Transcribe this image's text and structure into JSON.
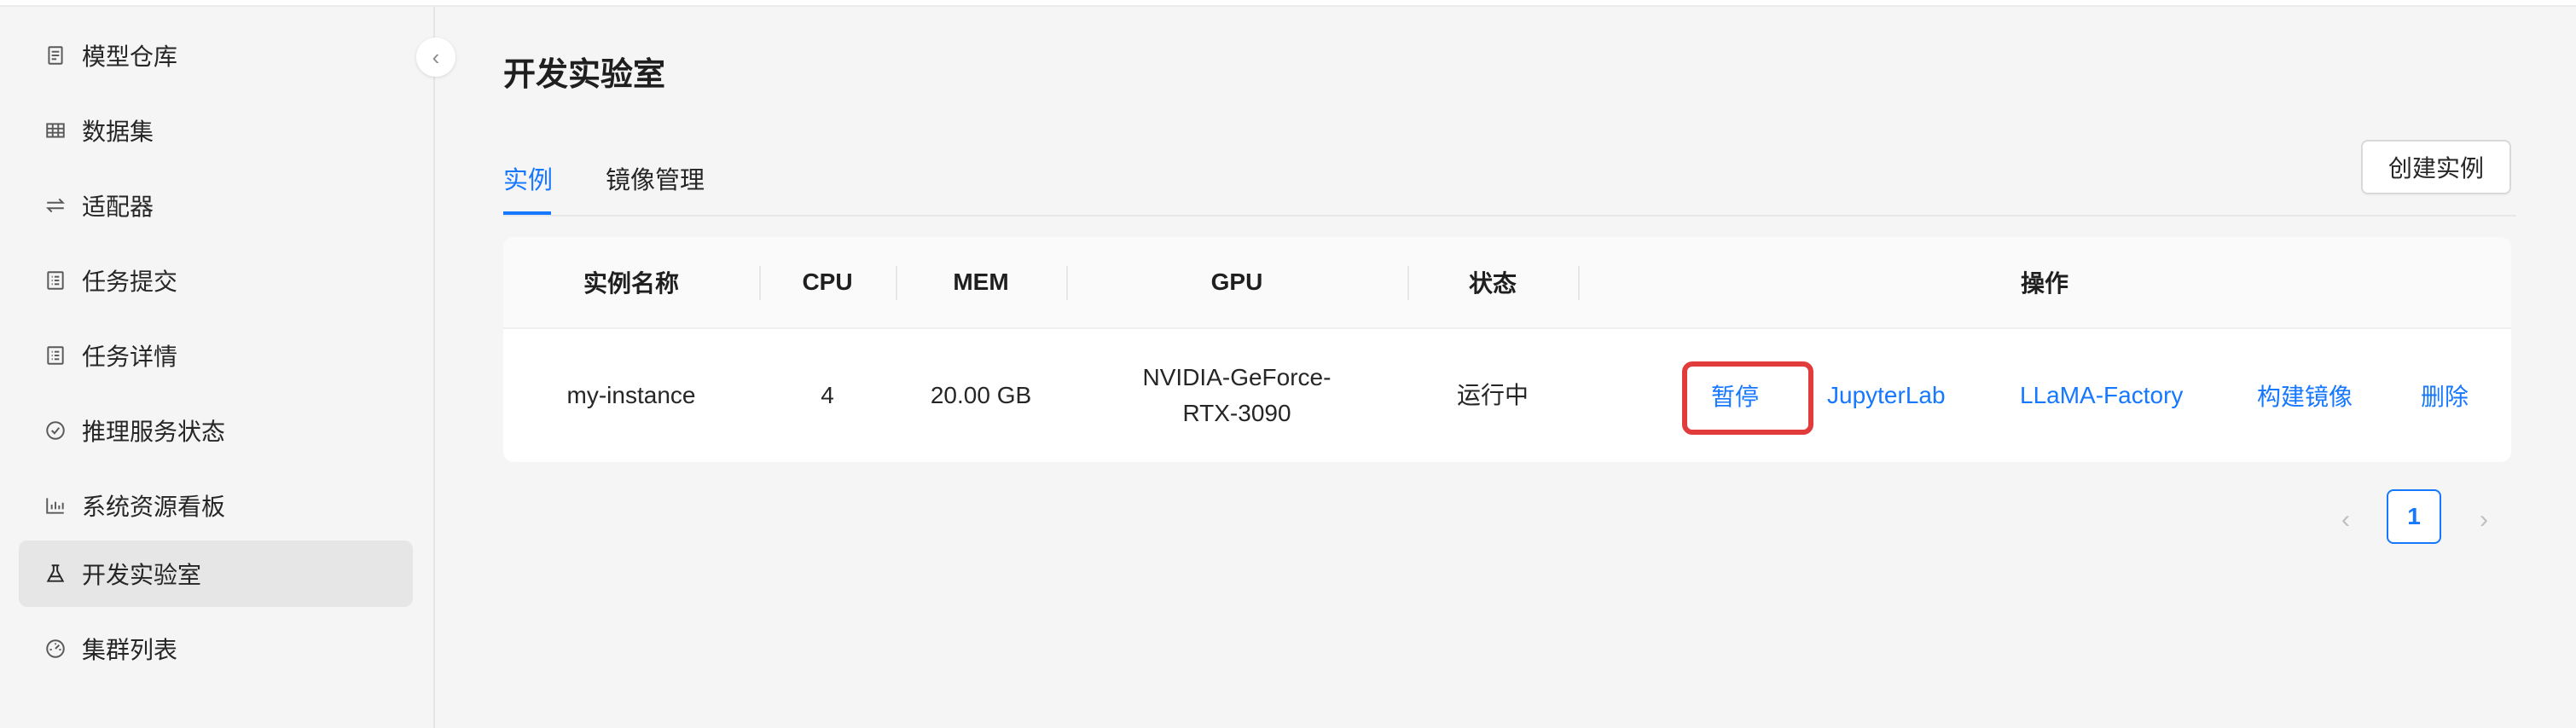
{
  "sidebar": {
    "collapse_icon": "chevron-left-icon",
    "items": [
      {
        "label": "模型仓库",
        "icon": "file-icon"
      },
      {
        "label": "数据集",
        "icon": "table-icon"
      },
      {
        "label": "适配器",
        "icon": "swap-icon"
      },
      {
        "label": "任务提交",
        "icon": "form-icon"
      },
      {
        "label": "任务详情",
        "icon": "profile-icon"
      },
      {
        "label": "推理服务状态",
        "icon": "check-circle-icon"
      },
      {
        "label": "系统资源看板",
        "icon": "bar-chart-icon"
      },
      {
        "label": "开发实验室",
        "icon": "flask-icon",
        "active": true
      },
      {
        "label": "集群列表",
        "icon": "dashboard-icon"
      }
    ]
  },
  "main": {
    "title": "开发实验室",
    "tabs": [
      {
        "label": "实例",
        "active": true
      },
      {
        "label": "镜像管理",
        "active": false
      }
    ],
    "create_button": "创建实例",
    "table": {
      "columns": [
        "实例名称",
        "CPU",
        "MEM",
        "GPU",
        "状态",
        "操作"
      ],
      "rows": [
        {
          "name": "my-instance",
          "cpu": "4",
          "mem": "20.00 GB",
          "gpu": "NVIDIA-GeForce-RTX-3090",
          "status": "运行中",
          "actions": [
            "暂停",
            "JupyterLab",
            "LLaMA-Factory",
            "构建镜像",
            "删除"
          ]
        }
      ]
    },
    "pagination": {
      "current_page": "1",
      "prev_icon": "chevron-left-icon",
      "next_icon": "chevron-right-icon"
    }
  },
  "colors": {
    "accent": "#1677ff",
    "highlight": "#e23b3b",
    "sidebar_active_bg": "#e6e6e6"
  }
}
